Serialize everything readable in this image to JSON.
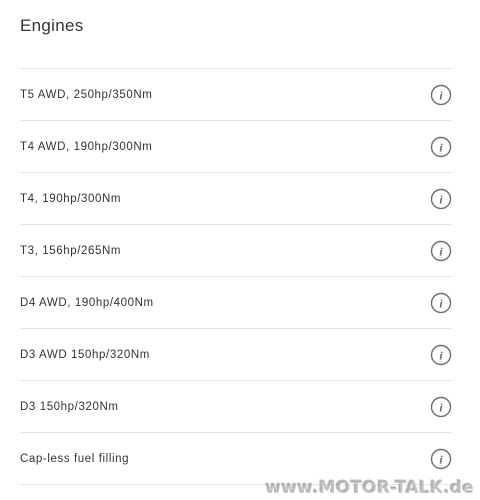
{
  "section": {
    "title": "Engines"
  },
  "items": [
    {
      "label": "T5 AWD, 250hp/350Nm",
      "icon": "info-icon"
    },
    {
      "label": "T4 AWD, 190hp/300Nm",
      "icon": "info-icon"
    },
    {
      "label": "T4, 190hp/300Nm",
      "icon": "info-icon"
    },
    {
      "label": "T3, 156hp/265Nm",
      "icon": "info-icon"
    },
    {
      "label": "D4 AWD, 190hp/400Nm",
      "icon": "info-icon"
    },
    {
      "label": "D3 AWD 150hp/320Nm",
      "icon": "info-icon"
    },
    {
      "label": "D3 150hp/320Nm",
      "icon": "info-icon"
    },
    {
      "label": "Cap-less fuel filling",
      "icon": "info-icon"
    }
  ],
  "watermark": {
    "text": "www.MOTOR-TALK.de"
  },
  "colors": {
    "divider": "#e3e3e3",
    "icon": "#6f6f6f",
    "text": "#333333"
  }
}
